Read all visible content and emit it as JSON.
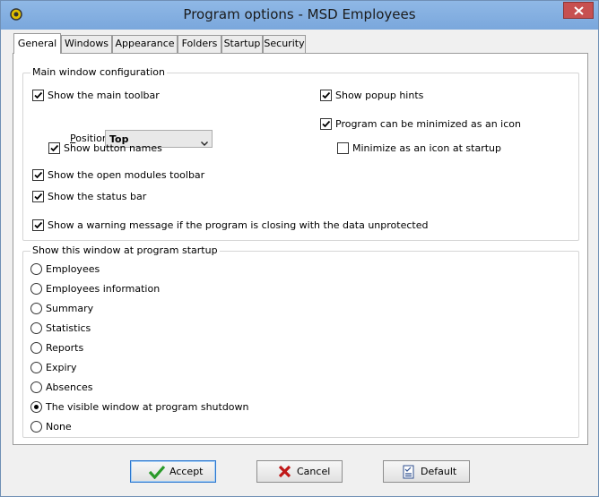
{
  "window": {
    "title": "Program options - MSD Employees"
  },
  "tabs": [
    "General",
    "Windows",
    "Appearance",
    "Folders",
    "Startup",
    "Security"
  ],
  "main_window_config": {
    "legend": "Main window configuration",
    "show_main_toolbar": {
      "label": "Show the main toolbar",
      "checked": true
    },
    "position": {
      "label": "Position",
      "value": "Top"
    },
    "show_button_names": {
      "label": "Show button names",
      "checked": true
    },
    "show_open_modules_toolbar": {
      "label": "Show the open modules toolbar",
      "checked": true
    },
    "show_status_bar": {
      "label": "Show the status bar",
      "checked": true
    },
    "show_warning": {
      "label": "Show a warning message if the program is closing with the data unprotected",
      "checked": true
    },
    "show_popup_hints": {
      "label": "Show popup hints",
      "checked": true
    },
    "minimize_as_icon": {
      "label": "Program can be minimized as an icon",
      "checked": true
    },
    "minimize_at_startup": {
      "label": "Minimize as an icon at startup",
      "checked": false
    }
  },
  "startup_window": {
    "legend": "Show this window at program startup",
    "options": [
      "Employees",
      "Employees information",
      "Summary",
      "Statistics",
      "Reports",
      "Expiry",
      "Absences",
      "The visible window at program shutdown",
      "None"
    ],
    "selected": "The visible window at program shutdown"
  },
  "buttons": {
    "accept": "Accept",
    "cancel": "Cancel",
    "default": "Default"
  }
}
